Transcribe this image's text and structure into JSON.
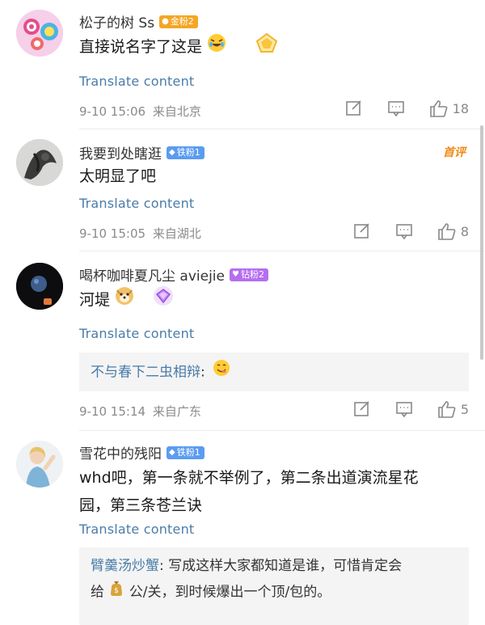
{
  "comments": [
    {
      "username": "松子的树 Ss",
      "badge": "金粉2",
      "text": "直接说名字了这是",
      "translate": "Translate content",
      "time": "9-10 15:06",
      "location": "来自北京",
      "likes": "18"
    },
    {
      "username": "我要到处瞎逛",
      "badge": "铁粉1",
      "tag": "首评",
      "text": "太明显了吧",
      "translate": "Translate content",
      "time": "9-10 15:05",
      "location": "来自湖北",
      "likes": "8"
    },
    {
      "username": "喝杯咖啡夏凡尘 aviejie",
      "badge": "钻粉2",
      "text": "河堤",
      "translate": "Translate content",
      "reply_name": "不与春下二虫相辩",
      "reply_sep": ":",
      "time": "9-10 15:14",
      "location": "来自广东",
      "likes": "5"
    },
    {
      "username": "雪花中的残阳",
      "badge": "铁粉1",
      "text_line1": "whd吧，第一条就不举例了，第二条出道演流星花",
      "text_line2": "园，第三条苍兰诀",
      "translate": "Translate content",
      "reply_name": "臂羹汤炒蟹",
      "reply_text1": ": 写成这样大家都知道是谁，可惜肯定会",
      "reply_text2_a": "给",
      "reply_text2_b": "公/关，到时候爆出一个顶/包的。"
    }
  ],
  "colors": {
    "link": "#4a7ca8",
    "meta": "#8a8a8a",
    "first_tag": "#f08a16"
  }
}
